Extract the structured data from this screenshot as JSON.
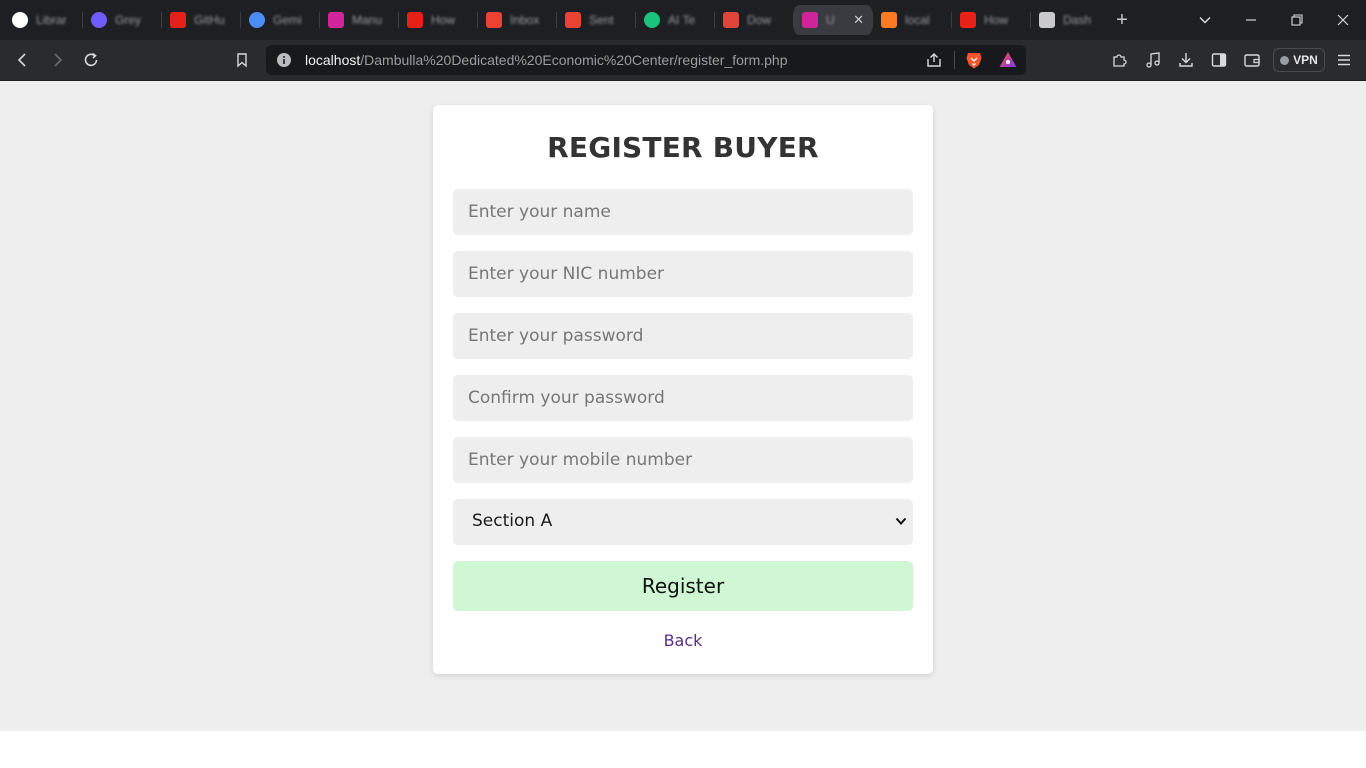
{
  "browser": {
    "tabs": [
      {
        "title": "Librar",
        "favicon": "github-icon",
        "color": "#ffffff"
      },
      {
        "title": "Grey",
        "favicon": "globe-icon",
        "color": "#6f5cff"
      },
      {
        "title": "GitHu",
        "favicon": "youtube-icon",
        "color": "#e62117"
      },
      {
        "title": "Gemi",
        "favicon": "gemini-icon",
        "color": "#4b8df8"
      },
      {
        "title": "Manu",
        "favicon": "app-icon",
        "color": "#d0259a"
      },
      {
        "title": "How",
        "favicon": "youtube-icon",
        "color": "#e62117"
      },
      {
        "title": "Inbox",
        "favicon": "gmail-icon",
        "color": "#ea4335"
      },
      {
        "title": "Sent",
        "favicon": "gmail-icon",
        "color": "#ea4335"
      },
      {
        "title": "AI Te",
        "favicon": "chatgpt-icon",
        "color": "#19c37d"
      },
      {
        "title": "Dow",
        "favicon": "app-icon",
        "color": "#e0453a"
      },
      {
        "title": "U",
        "favicon": "app-icon",
        "color": "#d0259a"
      },
      {
        "title": "local",
        "favicon": "xampp-icon",
        "color": "#fb7a24"
      },
      {
        "title": "How",
        "favicon": "youtube-icon",
        "color": "#e62117"
      },
      {
        "title": "Dash",
        "favicon": "app-icon",
        "color": "#c9c9cc"
      }
    ],
    "active_tab_index": 10,
    "url_host": "localhost",
    "url_path": "/Dambulla%20Dedicated%20Economic%20Center/register_form.php",
    "vpn_label": "VPN"
  },
  "form": {
    "title": "REGISTER BUYER",
    "name_placeholder": "Enter your name",
    "nic_placeholder": "Enter your NIC number",
    "password_placeholder": "Enter your password",
    "confirm_placeholder": "Confirm your password",
    "mobile_placeholder": "Enter your mobile number",
    "section_value": "Section A",
    "register_label": "Register",
    "back_label": "Back"
  }
}
